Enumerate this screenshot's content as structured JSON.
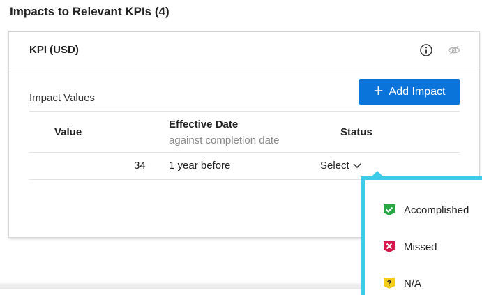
{
  "section": {
    "title": "Impacts to Relevant KPIs (4)"
  },
  "card": {
    "title": "KPI (USD)",
    "impact_label": "Impact Values",
    "add_button_label": "Add Impact",
    "columns": {
      "value": "Value",
      "effective_date": "Effective Date",
      "effective_date_sub": "against completion date",
      "status": "Status"
    },
    "rows": [
      {
        "value": "34",
        "effective_date": "1 year before",
        "status": "Select"
      }
    ]
  },
  "status_dropdown": {
    "options": [
      {
        "label": "Accomplished",
        "icon": "check-badge-icon",
        "color": "#27a844"
      },
      {
        "label": "Missed",
        "icon": "x-badge-icon",
        "color": "#d9184e"
      },
      {
        "label": "N/A",
        "icon": "question-badge-icon",
        "color": "#f2cf1c"
      }
    ]
  },
  "colors": {
    "primary": "#0a74da",
    "dropdown_border": "#3dcbe8"
  }
}
